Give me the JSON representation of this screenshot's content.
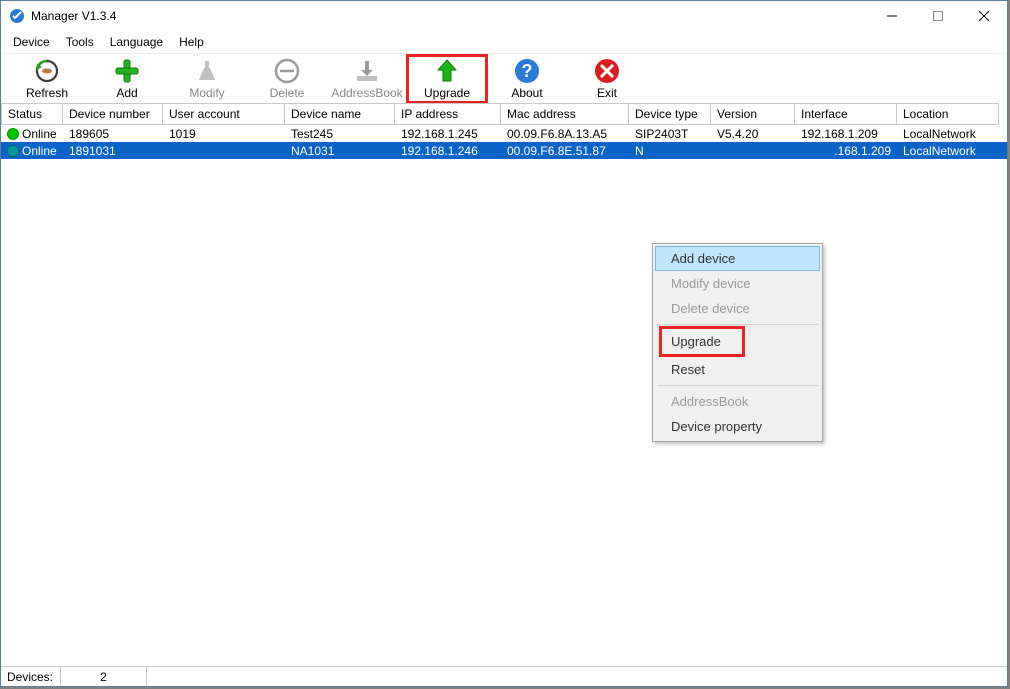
{
  "title": "Manager V1.3.4",
  "menu": [
    "Device",
    "Tools",
    "Language",
    "Help"
  ],
  "toolbar": {
    "refresh": "Refresh",
    "add": "Add",
    "modify": "Modify",
    "delete": "Delete",
    "addressbook": "AddressBook",
    "upgrade": "Upgrade",
    "about": "About",
    "exit": "Exit"
  },
  "columns": {
    "status": "Status",
    "devnum": "Device number",
    "user": "User account",
    "devname": "Device name",
    "ip": "IP address",
    "mac": "Mac address",
    "type": "Device type",
    "ver": "Version",
    "iface": "Interface",
    "loc": "Location"
  },
  "rows": [
    {
      "status": "Online",
      "devnum": "189605",
      "user": "1019",
      "devname": "Test245",
      "ip": "192.168.1.245",
      "mac": "00.09.F6.8A.13.A5",
      "type": "SIP2403T",
      "ver": "V5.4.20",
      "iface": "192.168.1.209",
      "loc": "LocalNetwork"
    },
    {
      "status": "Online",
      "devnum": "1891031",
      "user": "",
      "devname": "NA1031",
      "ip": "192.168.1.246",
      "mac": "00.09.F6.8E.51.87",
      "type": "N",
      "ver": "",
      "iface": ".168.1.209",
      "loc": "LocalNetwork"
    }
  ],
  "context_menu": {
    "add": "Add device",
    "modify": "Modify device",
    "delete": "Delete device",
    "upgrade": "Upgrade",
    "reset": "Reset",
    "addressbook": "AddressBook",
    "property": "Device property"
  },
  "statusbar": {
    "label": "Devices:",
    "count": "2"
  }
}
